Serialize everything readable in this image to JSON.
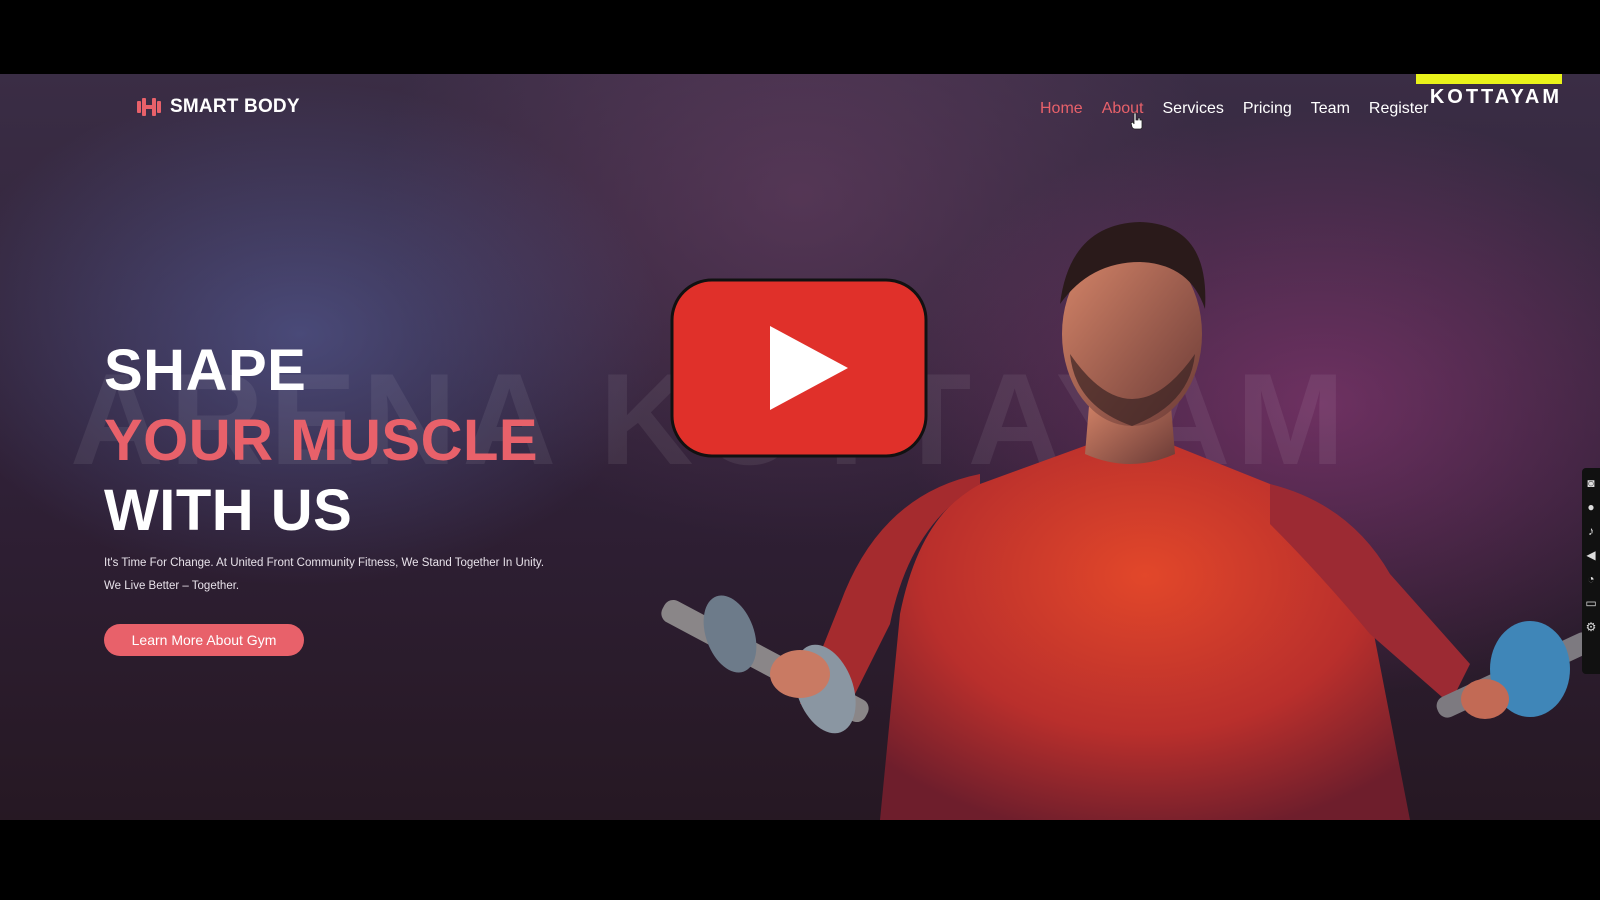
{
  "brand": {
    "name": "SMART BODY",
    "logo_icon": "dumbbell-icon"
  },
  "nav": {
    "items": [
      {
        "label": "Home",
        "state": "active"
      },
      {
        "label": "About",
        "state": "hover"
      },
      {
        "label": "Services",
        "state": "normal"
      },
      {
        "label": "Pricing",
        "state": "normal"
      },
      {
        "label": "Team",
        "state": "normal"
      },
      {
        "label": "Register",
        "state": "normal"
      }
    ]
  },
  "overlay": {
    "text": "KOTTAYAM"
  },
  "watermark": "ARENA KOTTAYAM",
  "hero": {
    "line1": "SHAPE",
    "line2": "YOUR MUSCLE",
    "line3": "WITH US",
    "subtext_line1": "It's Time For Change. At United Front Community Fitness, We Stand Together In Unity.",
    "subtext_line2": "We Live Better – Together.",
    "cta_label": "Learn More About Gym"
  },
  "video": {
    "play_icon": "play-icon"
  },
  "colors": {
    "accent": "#e8616a",
    "play_red": "#e0302a",
    "overlay_yellow": "#e9f21a"
  }
}
